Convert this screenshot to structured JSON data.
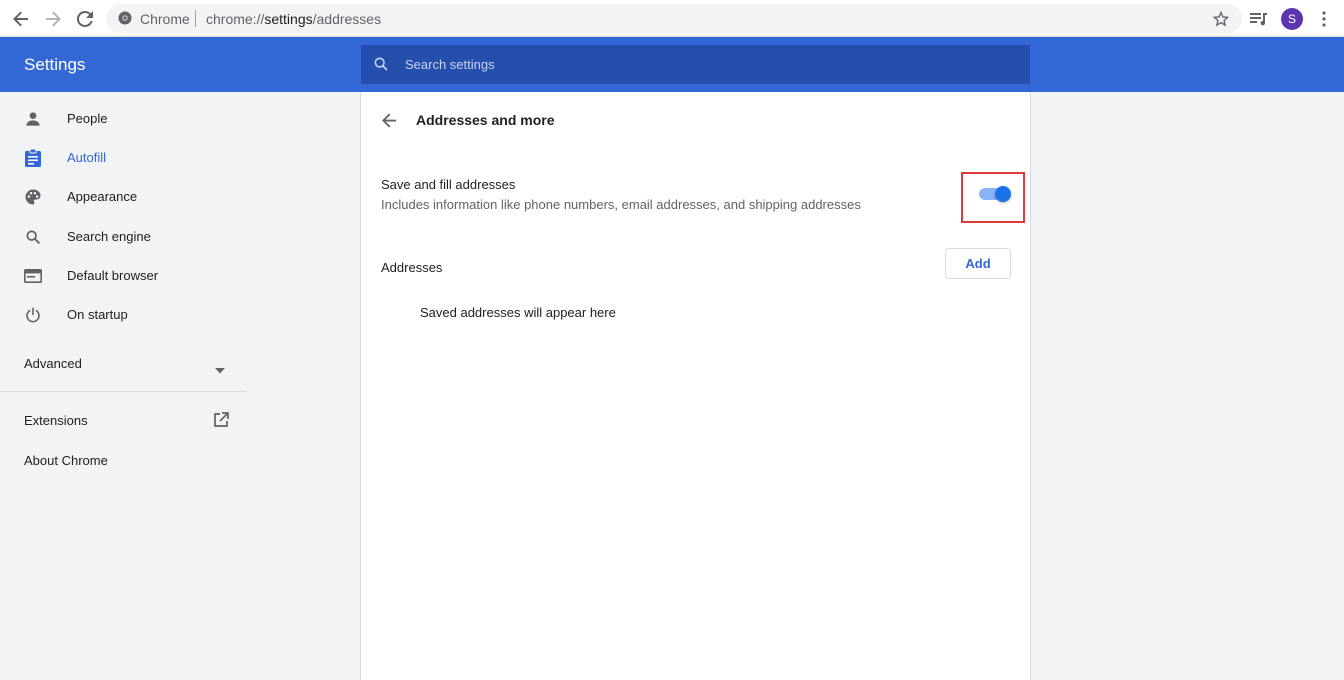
{
  "browser": {
    "site_name": "Chrome",
    "url_scheme": "chrome://",
    "url_host": "settings",
    "url_path": "/addresses",
    "avatar_letter": "S"
  },
  "header": {
    "title": "Settings",
    "search_placeholder": "Search settings"
  },
  "sidebar": {
    "items": [
      {
        "label": "People",
        "icon": "person-icon"
      },
      {
        "label": "Autofill",
        "icon": "clipboard-icon",
        "active": true
      },
      {
        "label": "Appearance",
        "icon": "palette-icon"
      },
      {
        "label": "Search engine",
        "icon": "search-icon"
      },
      {
        "label": "Default browser",
        "icon": "browser-window-icon"
      },
      {
        "label": "On startup",
        "icon": "power-icon"
      }
    ],
    "advanced_label": "Advanced",
    "extensions_label": "Extensions",
    "about_label": "About Chrome"
  },
  "main": {
    "page_title": "Addresses and more",
    "save_fill": {
      "title": "Save and fill addresses",
      "subtitle": "Includes information like phone numbers, email addresses, and shipping addresses",
      "enabled": true
    },
    "addresses_label": "Addresses",
    "add_button_label": "Add",
    "empty_text": "Saved addresses will appear here"
  },
  "colors": {
    "accent": "#3367d6",
    "header_bg": "#3367d6",
    "toggle_on": "#1a73e8",
    "highlight": "#e0393e"
  }
}
